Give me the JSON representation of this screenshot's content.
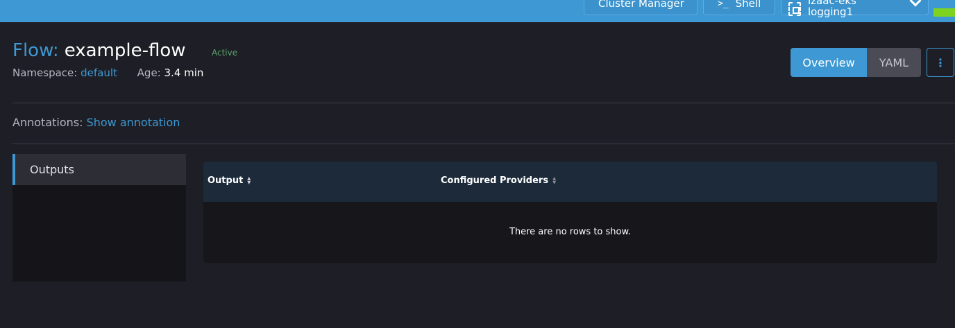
{
  "topbar": {
    "cluster_manager_label": "Cluster Manager",
    "shell_label": "Shell",
    "shell_icon": "terminal-icon",
    "context_line1": "izaac-eks",
    "context_line2": "logging1",
    "accent_color": "#3d98d3"
  },
  "header": {
    "type_label": "Flow:",
    "name": "example-flow",
    "status": "Active",
    "namespace_label": "Namespace:",
    "namespace_value": "default",
    "age_label": "Age:",
    "age_value": "3.4 min"
  },
  "view_toggle": {
    "overview_label": "Overview",
    "yaml_label": "YAML",
    "actions_icon": "⋮"
  },
  "annotations": {
    "label": "Annotations:",
    "link": "Show annotation"
  },
  "tabs": [
    {
      "label": "Outputs",
      "active": true
    }
  ],
  "table": {
    "columns": [
      "Output",
      "Configured Providers"
    ],
    "empty_message": "There are no rows to show."
  }
}
